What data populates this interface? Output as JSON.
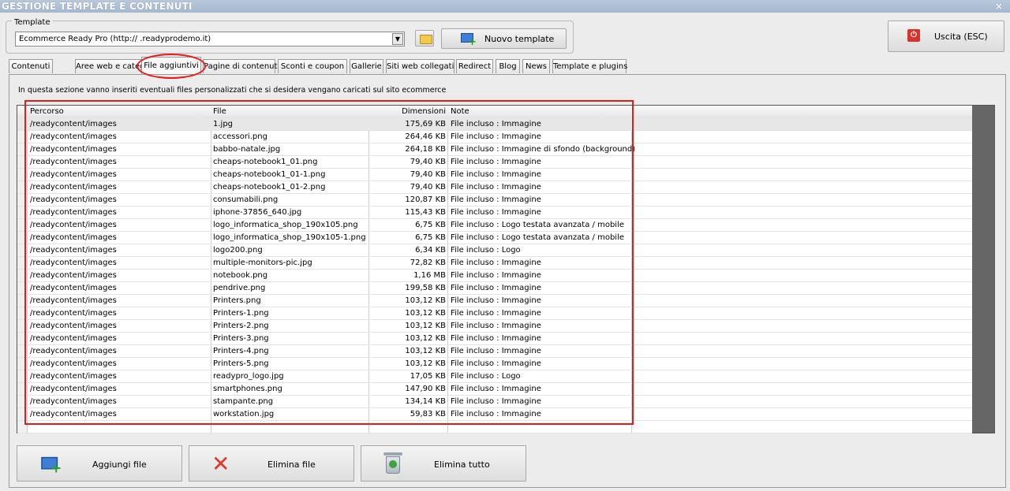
{
  "window": {
    "title": "GESTIONE TEMPLATE E CONTENUTI",
    "close_glyph": "×"
  },
  "template": {
    "group_label": "Template",
    "selected": "Ecommerce Ready Pro (http://     .readyprodemo.it)",
    "new_label": "Nuovo template"
  },
  "exit": {
    "label": "Uscita (ESC)"
  },
  "tabs": [
    {
      "label": "Contenuti"
    },
    {
      "label": "Aree web e categorie"
    },
    {
      "label": "File aggiuntivi"
    },
    {
      "label": "Pagine di contenuti"
    },
    {
      "label": "Sconti e coupon"
    },
    {
      "label": "Gallerie"
    },
    {
      "label": "Siti web collegati"
    },
    {
      "label": "Redirect"
    },
    {
      "label": "Blog"
    },
    {
      "label": "News"
    },
    {
      "label": "Template e plugins"
    }
  ],
  "active_tab": 2,
  "description": "In questa sezione vanno inseriti eventuali files personalizzati che si desidera vengano caricati sul sito ecommerce",
  "table": {
    "headers": {
      "path": "Percorso",
      "file": "File",
      "size": "Dimensioni",
      "note": "Note"
    },
    "rows": [
      {
        "path": "/readycontent/images",
        "file": "1.jpg",
        "size": "175,69 KB",
        "note": "File incluso : Immagine"
      },
      {
        "path": "/readycontent/images",
        "file": "accessori.png",
        "size": "264,46 KB",
        "note": "File incluso : Immagine"
      },
      {
        "path": "/readycontent/images",
        "file": "babbo-natale.jpg",
        "size": "264,18 KB",
        "note": "File incluso : Immagine di sfondo (background)"
      },
      {
        "path": "/readycontent/images",
        "file": "cheaps-notebook1_01.png",
        "size": "79,40 KB",
        "note": "File incluso : Immagine"
      },
      {
        "path": "/readycontent/images",
        "file": "cheaps-notebook1_01-1.png",
        "size": "79,40 KB",
        "note": "File incluso : Immagine"
      },
      {
        "path": "/readycontent/images",
        "file": "cheaps-notebook1_01-2.png",
        "size": "79,40 KB",
        "note": "File incluso : Immagine"
      },
      {
        "path": "/readycontent/images",
        "file": "consumabili.png",
        "size": "120,87 KB",
        "note": "File incluso : Immagine"
      },
      {
        "path": "/readycontent/images",
        "file": "iphone-37856_640.jpg",
        "size": "115,43 KB",
        "note": "File incluso : Immagine"
      },
      {
        "path": "/readycontent/images",
        "file": "logo_informatica_shop_190x105.png",
        "size": "6,75 KB",
        "note": "File incluso : Logo testata avanzata / mobile"
      },
      {
        "path": "/readycontent/images",
        "file": "logo_informatica_shop_190x105-1.png",
        "size": "6,75 KB",
        "note": "File incluso : Logo testata avanzata / mobile"
      },
      {
        "path": "/readycontent/images",
        "file": "logo200.png",
        "size": "6,34 KB",
        "note": "File incluso : Logo"
      },
      {
        "path": "/readycontent/images",
        "file": "multiple-monitors-pic.jpg",
        "size": "72,82 KB",
        "note": "File incluso : Immagine"
      },
      {
        "path": "/readycontent/images",
        "file": "notebook.png",
        "size": "1,16 MB",
        "note": "File incluso : Immagine"
      },
      {
        "path": "/readycontent/images",
        "file": "pendrive.png",
        "size": "199,58 KB",
        "note": "File incluso : Immagine"
      },
      {
        "path": "/readycontent/images",
        "file": "Printers.png",
        "size": "103,12 KB",
        "note": "File incluso : Immagine"
      },
      {
        "path": "/readycontent/images",
        "file": "Printers-1.png",
        "size": "103,12 KB",
        "note": "File incluso : Immagine"
      },
      {
        "path": "/readycontent/images",
        "file": "Printers-2.png",
        "size": "103,12 KB",
        "note": "File incluso : Immagine"
      },
      {
        "path": "/readycontent/images",
        "file": "Printers-3.png",
        "size": "103,12 KB",
        "note": "File incluso : Immagine"
      },
      {
        "path": "/readycontent/images",
        "file": "Printers-4.png",
        "size": "103,12 KB",
        "note": "File incluso : Immagine"
      },
      {
        "path": "/readycontent/images",
        "file": "Printers-5.png",
        "size": "103,12 KB",
        "note": "File incluso : Immagine"
      },
      {
        "path": "/readycontent/images",
        "file": "readypro_logo.jpg",
        "size": "17,05 KB",
        "note": "File incluso : Logo"
      },
      {
        "path": "/readycontent/images",
        "file": "smartphones.png",
        "size": "147,90 KB",
        "note": "File incluso : Immagine"
      },
      {
        "path": "/readycontent/images",
        "file": "stampante.png",
        "size": "134,14 KB",
        "note": "File incluso : Immagine"
      },
      {
        "path": "/readycontent/images",
        "file": "workstation.jpg",
        "size": "59,83 KB",
        "note": "File incluso : Immagine"
      }
    ]
  },
  "actions": {
    "add": "Aggiungi file",
    "delete": "Elimina file",
    "delete_all": "Elimina tutto"
  },
  "icons": {
    "add": "add-file-icon",
    "delete": "delete-x-icon",
    "delete_all": "recycle-bin-icon",
    "exit": "power-icon",
    "folder": "folder-icon"
  },
  "colors": {
    "highlight": "#e51b1b",
    "titlebar": "#a5b8cf"
  }
}
